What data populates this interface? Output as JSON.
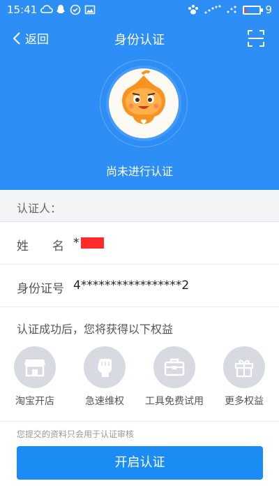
{
  "status_bar": {
    "time": "15:41",
    "battery_text": "9",
    "battery_level": 0.09
  },
  "nav": {
    "back_label": "返回",
    "title": "身份认证"
  },
  "avatar": {
    "status_text": "尚未进行认证"
  },
  "certifier": {
    "section_label": "认证人："
  },
  "fields": [
    {
      "label": "姓　　名",
      "value": "*"
    },
    {
      "label": "身份证号",
      "value": "4*****************2"
    }
  ],
  "benefits": {
    "title": "认证成功后，您将获得以下权益",
    "items": [
      {
        "label": "淘宝开店",
        "icon": "shop-icon"
      },
      {
        "label": "急速维权",
        "icon": "fist-icon"
      },
      {
        "label": "工具免费试用",
        "icon": "toolbox-icon"
      },
      {
        "label": "更多权益",
        "icon": "gift-icon"
      }
    ]
  },
  "footer": {
    "note": "您提交的资料只会用于认证审核",
    "button_label": "开启认证"
  },
  "colors": {
    "header": "#2d8ef5",
    "button": "#1b8cf3",
    "icon_bg": "#d7dbe1"
  }
}
